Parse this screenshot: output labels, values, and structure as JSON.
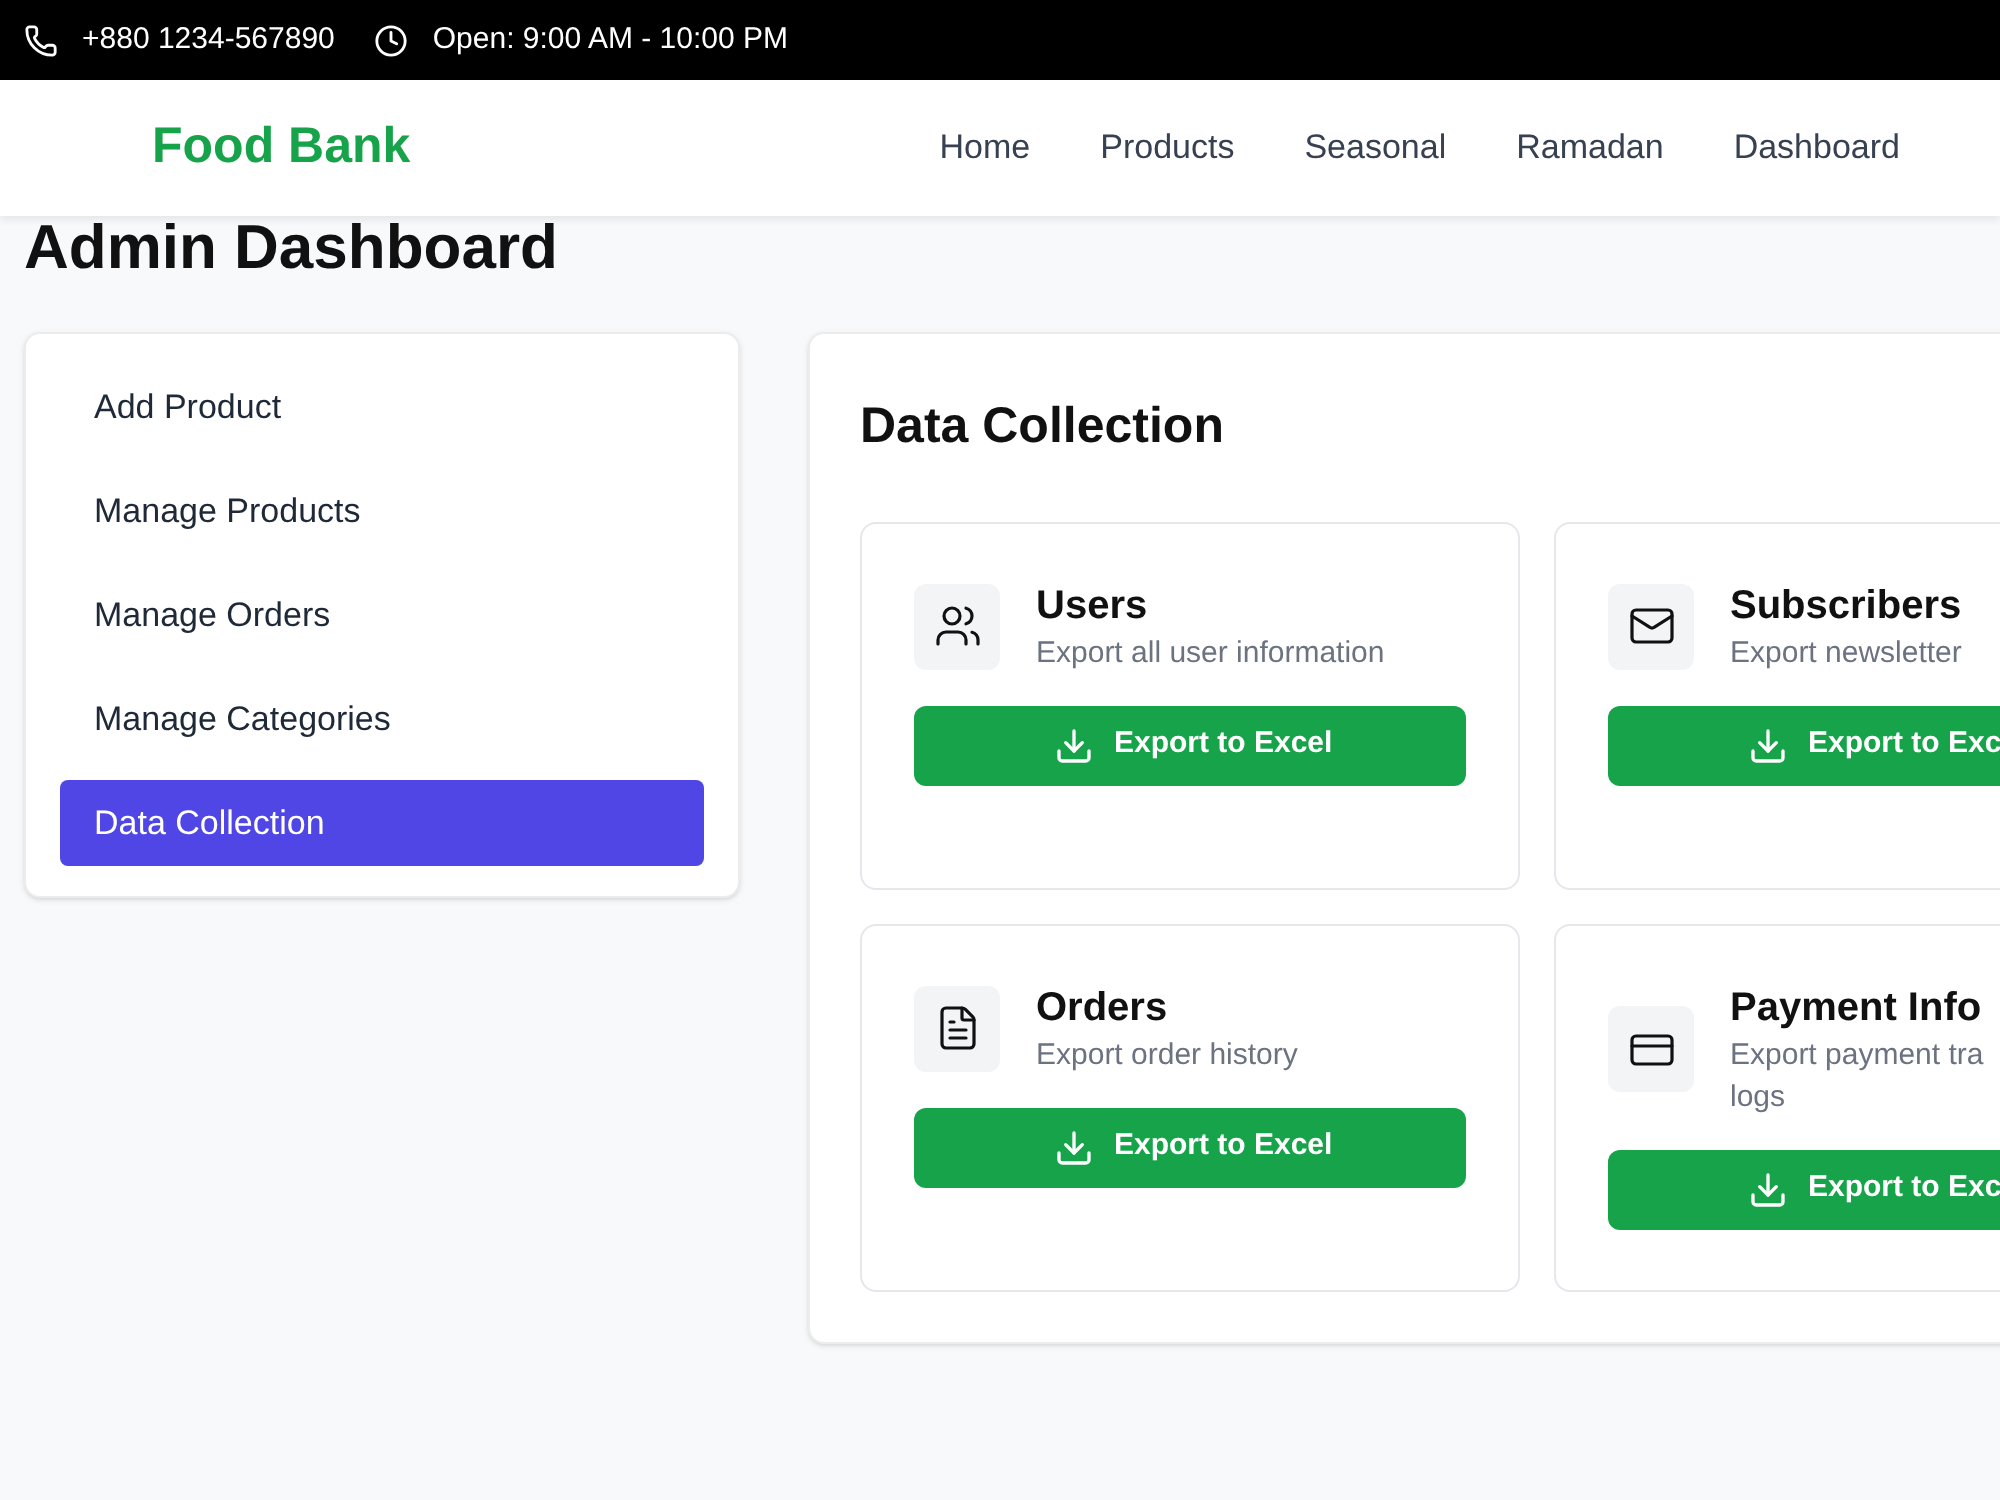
{
  "topbar": {
    "phone": "+880 1234-567890",
    "hours": "Open: 9:00 AM - 10:00 PM"
  },
  "header": {
    "logo": "Food Bank",
    "nav": [
      "Home",
      "Products",
      "Seasonal",
      "Ramadan",
      "Dashboard"
    ]
  },
  "page_title": "Admin Dashboard",
  "sidebar": {
    "items": [
      {
        "label": "Add Product",
        "selected": false
      },
      {
        "label": "Manage Products",
        "selected": false
      },
      {
        "label": "Manage Orders",
        "selected": false
      },
      {
        "label": "Manage Categories",
        "selected": false
      },
      {
        "label": "Data Collection",
        "selected": true
      }
    ]
  },
  "panel": {
    "title": "Data Collection",
    "cards": [
      {
        "kind": "users",
        "title": "Users",
        "description": [
          "Export all user information"
        ],
        "button": "Export to Excel"
      },
      {
        "kind": "mail",
        "title": "Subscribers",
        "description": [
          "Export newsletter"
        ],
        "button": "Export to Exc"
      },
      {
        "kind": "document",
        "title": "Orders",
        "description": [
          "Export order history"
        ],
        "button": "Export to Excel"
      },
      {
        "kind": "card",
        "title": "Payment Info",
        "description": [
          "Export payment tra",
          "logs"
        ],
        "button": "Export to Exc"
      }
    ]
  }
}
